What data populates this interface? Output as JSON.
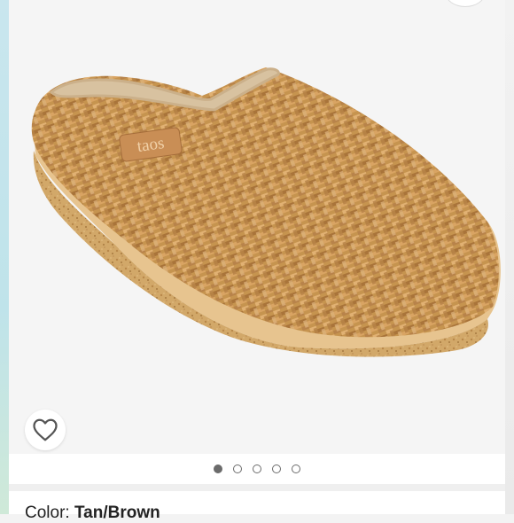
{
  "listing": {
    "brand_tag": "taos",
    "color_label": "Color:",
    "color_value": "Tan/Brown"
  },
  "carousel": {
    "image_count": 5,
    "active_index": 0
  },
  "icons": {
    "like": "heart-outline-icon"
  },
  "colors": {
    "accent_dot": "#6b6b6b",
    "cork": "#c9a06a",
    "weave": "#b98a4a"
  }
}
